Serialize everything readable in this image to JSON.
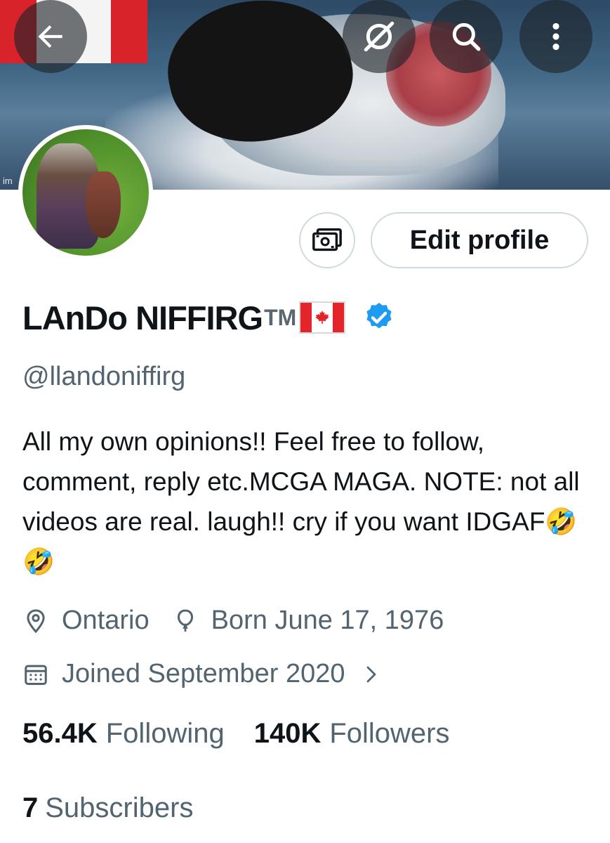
{
  "profile": {
    "display_name": "LAnDo NIFFIRG",
    "name_suffix": "TM",
    "flag_icon": "canada-flag-icon",
    "verified_icon": "verified-badge-icon",
    "handle": "@llandoniffirg",
    "bio": "All my own opinions!! Feel free to follow, comment, reply etc.MCGA MAGA. NOTE: not all videos are real. laugh!! cry if you want IDGAF🤣🤣",
    "location": "Ontario",
    "birthday": "Born June 17, 1976",
    "joined": "Joined September 2020",
    "following_count": "56.4K",
    "following_label": "Following",
    "followers_count": "140K",
    "followers_label": "Followers",
    "subscribers_count": "7",
    "subscribers_label": "Subscribers"
  },
  "banner": {
    "watermark_text": "im"
  },
  "actions": {
    "edit_profile_label": "Edit profile",
    "money_icon": "money-icon"
  },
  "header_icons": [
    "back-arrow-icon",
    "grok-icon",
    "search-icon",
    "more-icon"
  ],
  "colors": {
    "text_primary": "#0f1419",
    "text_secondary": "#536471",
    "verified_blue": "#1d9bf0",
    "border": "#cfd9de"
  }
}
